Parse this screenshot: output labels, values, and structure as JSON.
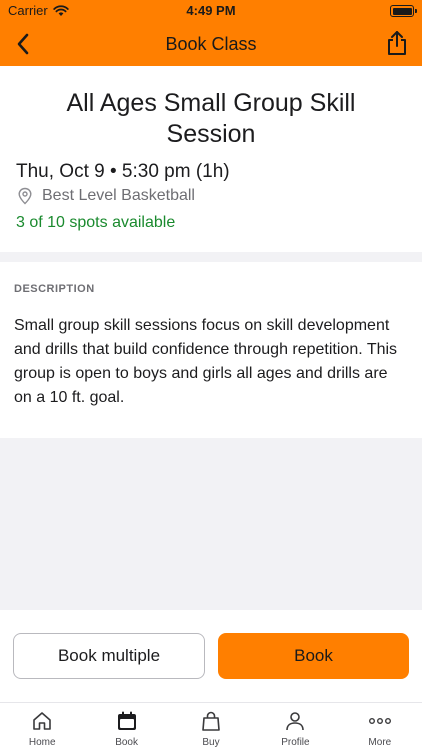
{
  "status_bar": {
    "carrier": "Carrier",
    "time": "4:49 PM"
  },
  "nav": {
    "title": "Book Class",
    "back_icon": "chevron-left-icon",
    "share_icon": "share-icon"
  },
  "class_info": {
    "title": "All Ages Small Group Skill Session",
    "datetime": "Thu, Oct 9 • 5:30 pm (1h)",
    "location": "Best Level Basketball",
    "spots": "3 of 10 spots available"
  },
  "description": {
    "heading": "DESCRIPTION",
    "body": "Small group skill sessions focus on skill development and drills that build confidence through repetition.  This group is open to boys and girls all ages and drills are on a 10 ft. goal."
  },
  "actions": {
    "book_multiple": "Book multiple",
    "book": "Book"
  },
  "tabs": [
    {
      "label": "Home",
      "icon": "home-icon"
    },
    {
      "label": "Book",
      "icon": "calendar-icon"
    },
    {
      "label": "Buy",
      "icon": "shopping-bag-icon"
    },
    {
      "label": "Profile",
      "icon": "person-icon"
    },
    {
      "label": "More",
      "icon": "more-dots-icon"
    }
  ],
  "colors": {
    "accent": "#ff7f00",
    "available": "#1a8a2e",
    "muted": "#6e6e73",
    "background_gray": "#f2f2f5"
  }
}
